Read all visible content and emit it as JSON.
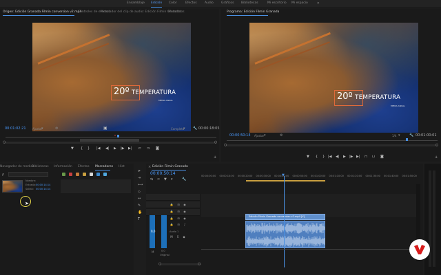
{
  "workspaces": [
    "Ensamblaje",
    "Edición",
    "Color",
    "Efectos",
    "Audio",
    "Gráficos",
    "Bibliotecas",
    "Mi escritorio",
    "Mi espacio"
  ],
  "workspace_more": "»",
  "source": {
    "tabs": [
      "Origen: Edición Granada Filmin conversion v2.mp4",
      "Controles de efectos",
      "Mezclador del clip de audio: Edición Filmin Granada",
      "Metadatos"
    ],
    "timecode": "00:01:02:21",
    "fit": "Ajustar",
    "quality": "Completa",
    "duration": "00:00:18:05"
  },
  "program": {
    "tab": "Programa: Edición Filmin Granada",
    "timecode": "00:00:50:14",
    "fit": "Ajustar",
    "ratio": "1/4",
    "duration": "00:01:00:01"
  },
  "overlay": {
    "degrees": "20º",
    "word": "TEMPERATURA",
    "sub": "MEDIA ANUAL"
  },
  "project": {
    "tabs": [
      "Navegador de medios",
      "Bibliotecas",
      "Información",
      "Efectos",
      "Marcadores",
      "Hist"
    ],
    "search_icon": "ρ",
    "fields": [
      {
        "label": "Nombre:",
        "value": ""
      },
      {
        "label": "Entrada:",
        "value": "00:00:14:14"
      },
      {
        "label": "Salida:",
        "value": "00:00:14:14"
      }
    ],
    "swatch_colors": [
      "#6a9a4a",
      "#c84040",
      "#c47a3a",
      "#caa040",
      "#d8d8d8",
      "#3a8ad0",
      "#50a8e0"
    ]
  },
  "timeline": {
    "close": "×",
    "title": "Edición Filmin Granada",
    "timecode": "00:00:50:14",
    "ruler": [
      "00:00:00:00",
      "00:00:10:00",
      "00:00:20:00",
      "00:00:30:00",
      "00:00:40:00",
      "00:00:50:00",
      "00:01:00:00",
      "00:01:10:00",
      "00:01:20:00",
      "00:01:30:00",
      "00:01:40:00",
      "00:01:50:00"
    ],
    "clip_label": "Edición Filmin Granada conversion v2.mp4 [V]",
    "track_label": "Audio 1",
    "volume": "0,0",
    "master": "Original"
  },
  "colors": {
    "accent": "#4a90e2",
    "clip": "#5f8fcc",
    "title_box": "#e06a3a",
    "logo_red": "#d81c1c"
  }
}
